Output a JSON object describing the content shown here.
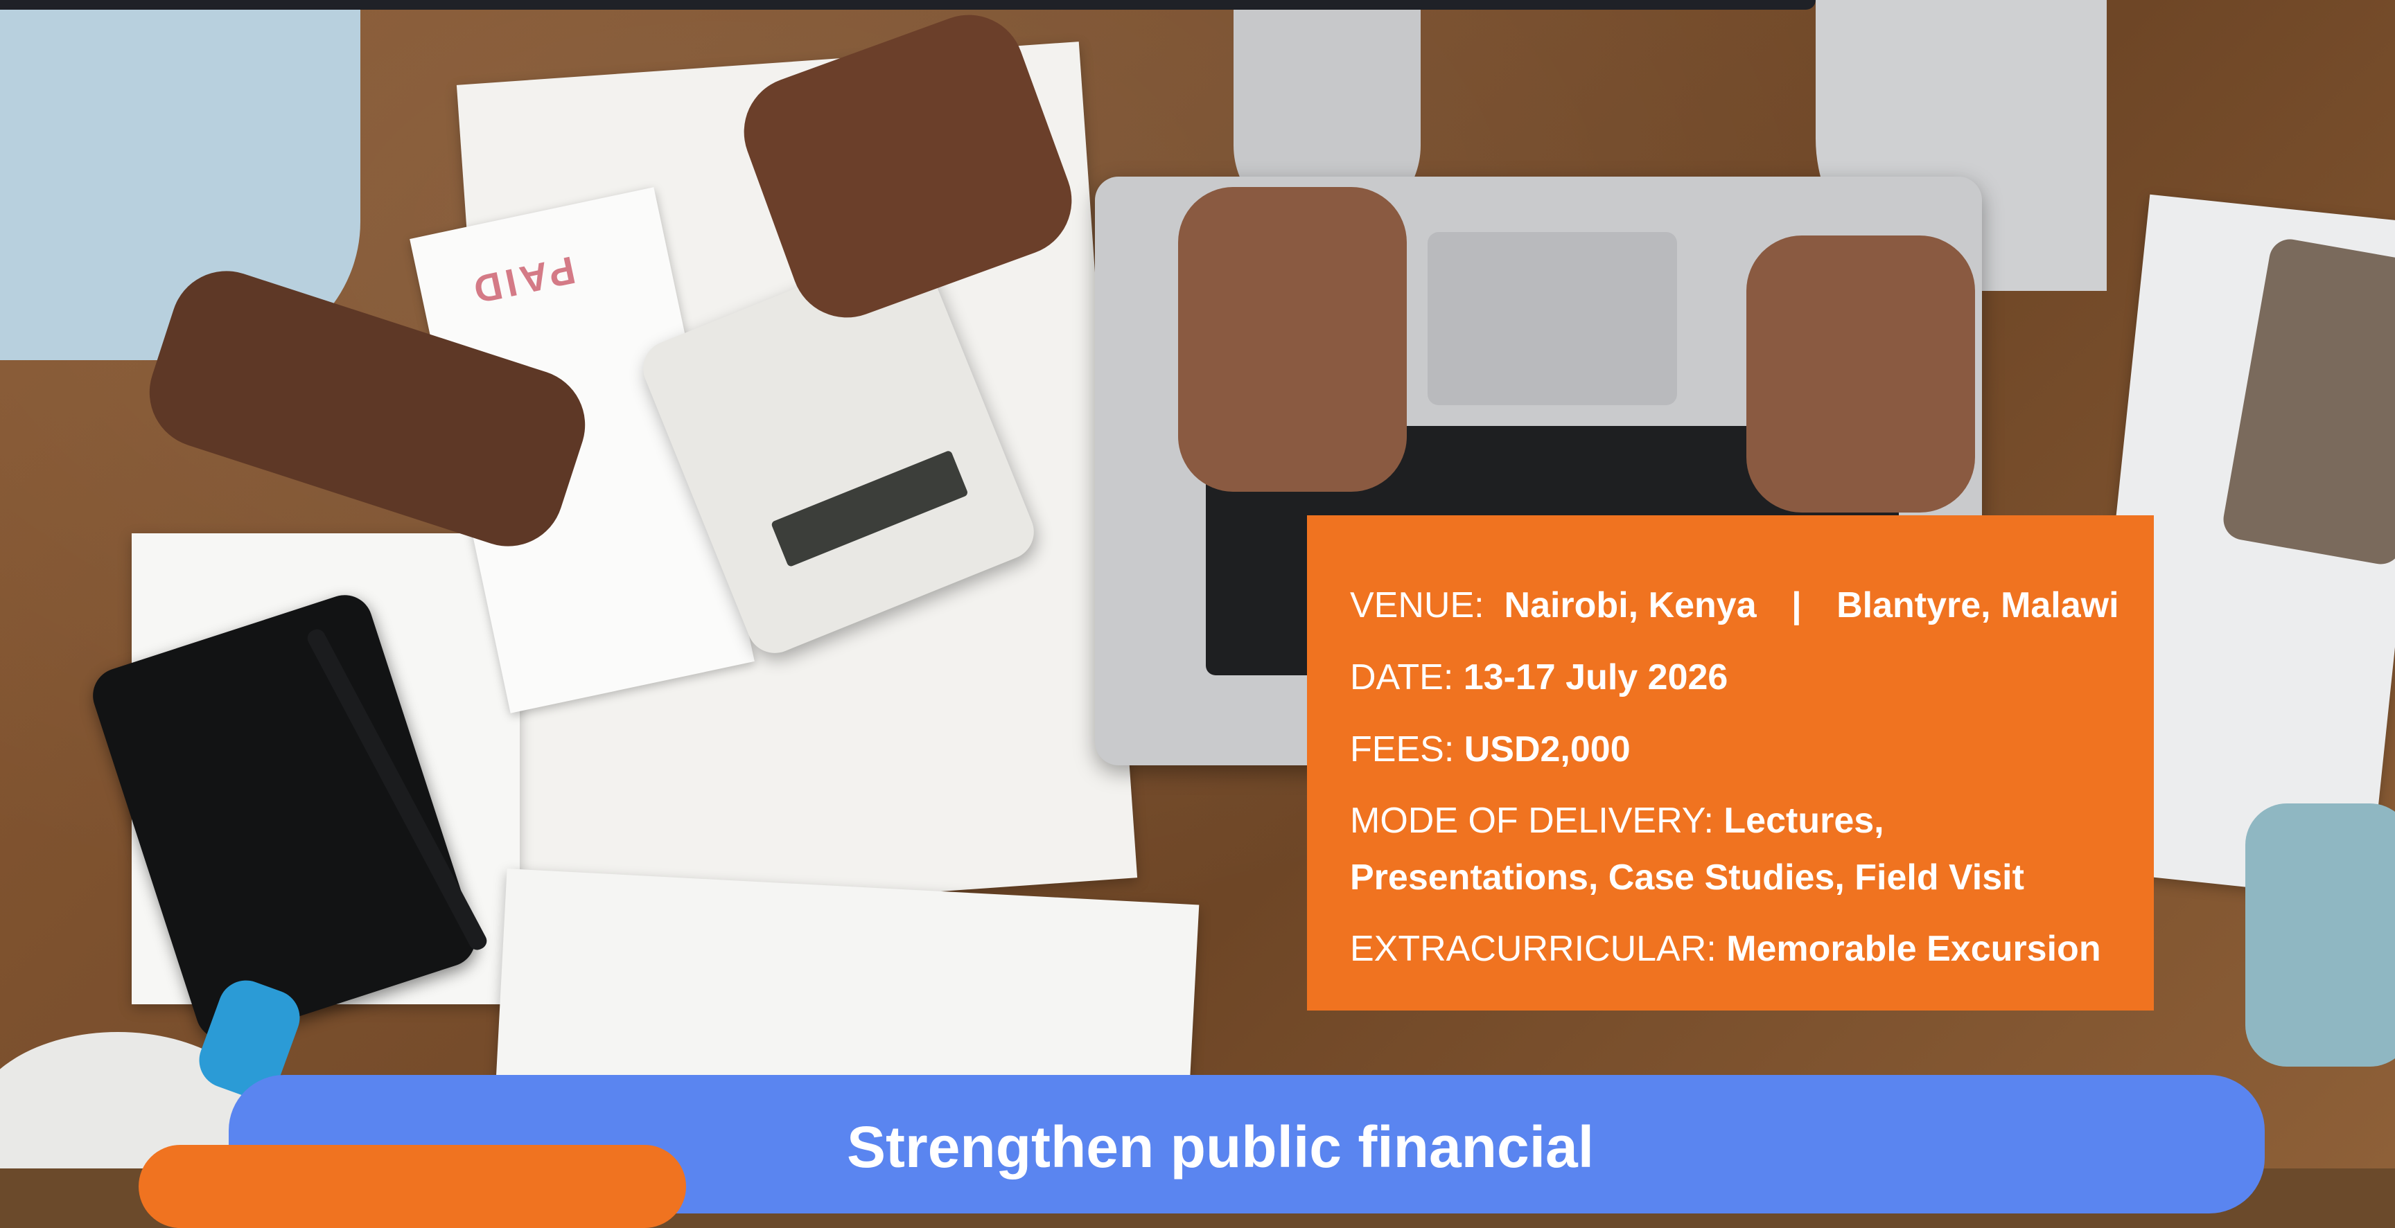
{
  "info": {
    "venue_label": "VENUE:",
    "venue_city1": "Nairobi, Kenya",
    "venue_sep": "|",
    "venue_city2": "Blantyre, Malawi",
    "date_label": "DATE:",
    "date_value": "13-17 July 2026",
    "fees_label": "FEES:",
    "fees_value": "USD2,000",
    "mode_label": "MODE OF DELIVERY:",
    "mode_value": "Lectures, Presentations, Case Studies, Field Visit",
    "extra_label": "EXTRACURRICULAR:",
    "extra_value": "Memorable Excursion"
  },
  "banner": {
    "headline": "Strengthen public financial"
  },
  "photo": {
    "receipt_stamp": "PAID"
  },
  "colors": {
    "accent_orange": "#f07320",
    "banner_blue": "#5a85f0",
    "top_bar": "#1f2127"
  }
}
